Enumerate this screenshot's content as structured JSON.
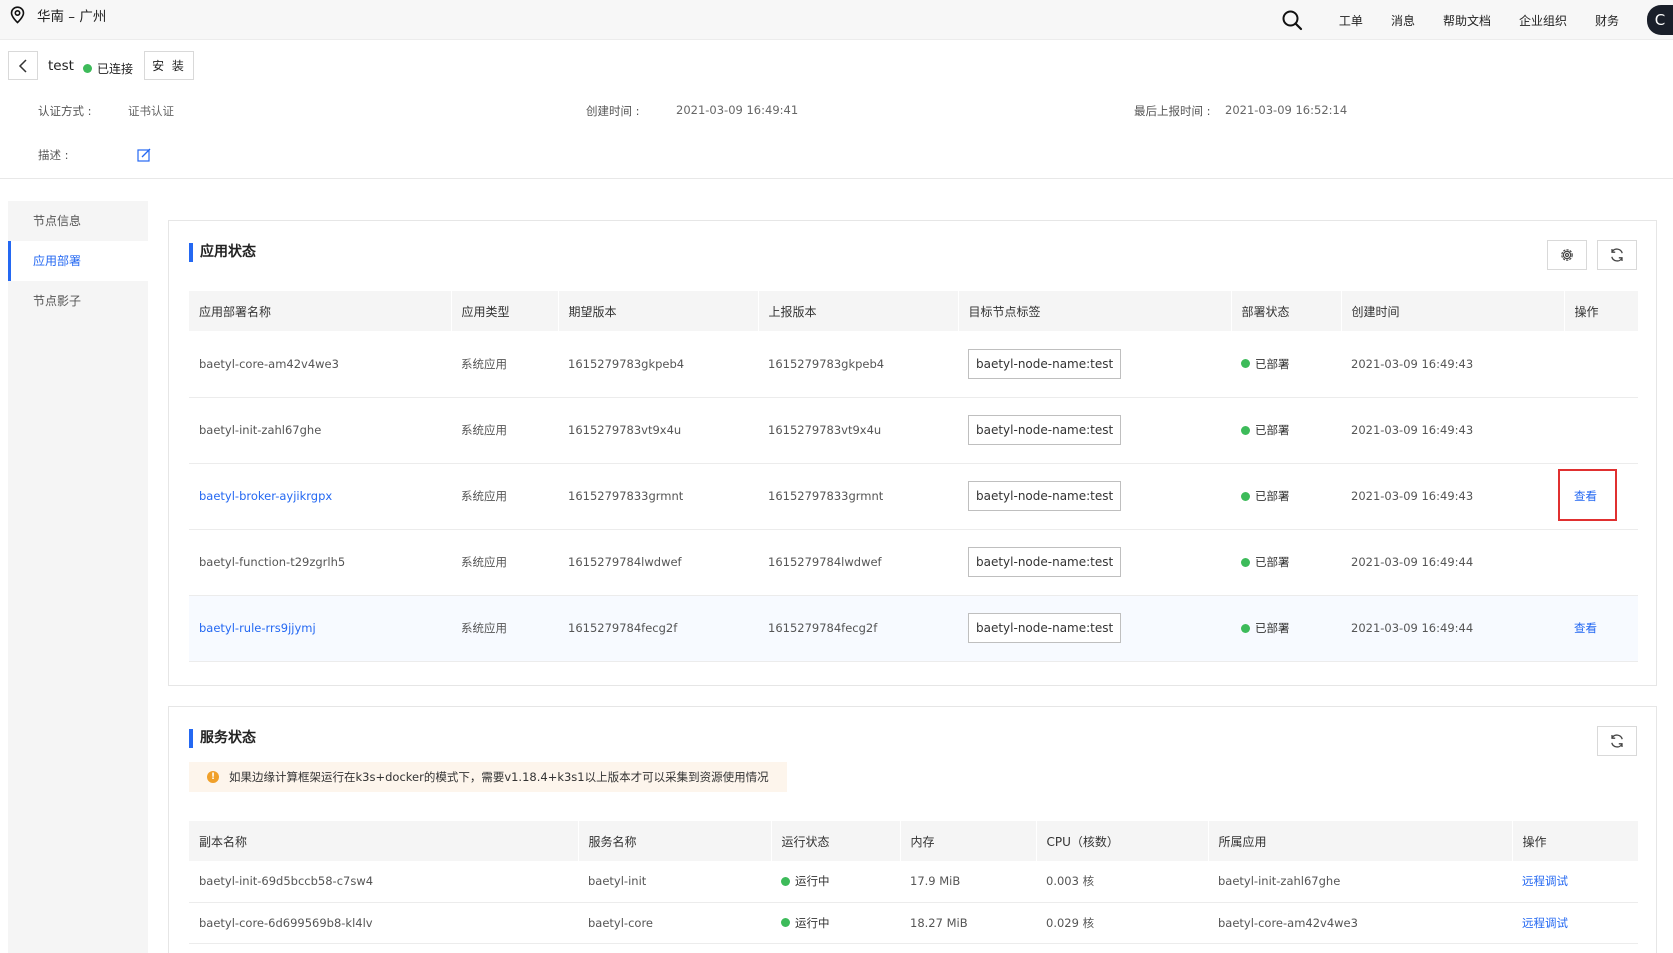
{
  "topbar": {
    "region": "华南 – 广州",
    "links": [
      "工单",
      "消息",
      "帮助文档",
      "企业组织",
      "财务"
    ],
    "avatar": "C"
  },
  "node": {
    "name": "test",
    "status": "已连接",
    "install_label": "安 装",
    "auth_label": "认证方式 :",
    "auth_value": "证书认证",
    "created_label": "创建时间 :",
    "created_value": "2021-03-09 16:49:41",
    "reported_label": "最后上报时间 :",
    "reported_value": "2021-03-09 16:52:14",
    "desc_label": "描述 :"
  },
  "sidenav": [
    "节点信息",
    "应用部署",
    "节点影子"
  ],
  "app_status": {
    "title": "应用状态",
    "columns": [
      "应用部署名称",
      "应用类型",
      "期望版本",
      "上报版本",
      "目标节点标签",
      "部署状态",
      "创建时间",
      "操作"
    ],
    "rows": [
      {
        "name": "baetyl-core-am42v4we3",
        "type": "系统应用",
        "expected": "1615279783gkpeb4",
        "reported": "1615279783gkpeb4",
        "tag": "baetyl-node-name:test",
        "status": "已部署",
        "created": "2021-03-09 16:49:43",
        "action": ""
      },
      {
        "name": "baetyl-init-zahl67ghe",
        "type": "系统应用",
        "expected": "1615279783vt9x4u",
        "reported": "1615279783vt9x4u",
        "tag": "baetyl-node-name:test",
        "status": "已部署",
        "created": "2021-03-09 16:49:43",
        "action": ""
      },
      {
        "name": "baetyl-broker-ayjikrgpx",
        "type": "系统应用",
        "expected": "16152797833grmnt",
        "reported": "16152797833grmnt",
        "tag": "baetyl-node-name:test",
        "status": "已部署",
        "created": "2021-03-09 16:49:43",
        "action": "查看"
      },
      {
        "name": "baetyl-function-t29zgrlh5",
        "type": "系统应用",
        "expected": "1615279784lwdwef",
        "reported": "1615279784lwdwef",
        "tag": "baetyl-node-name:test",
        "status": "已部署",
        "created": "2021-03-09 16:49:44",
        "action": ""
      },
      {
        "name": "baetyl-rule-rrs9jjymj",
        "type": "系统应用",
        "expected": "1615279784fecg2f",
        "reported": "1615279784fecg2f",
        "tag": "baetyl-node-name:test",
        "status": "已部署",
        "created": "2021-03-09 16:49:44",
        "action": "查看"
      }
    ]
  },
  "service_status": {
    "title": "服务状态",
    "warning": "如果边缘计算框架运行在k3s+docker的模式下，需要v1.18.4+k3s1以上版本才可以采集到资源使用情况",
    "columns": [
      "副本名称",
      "服务名称",
      "运行状态",
      "内存",
      "CPU（核数）",
      "所属应用",
      "操作"
    ],
    "rows": [
      {
        "replica": "baetyl-init-69d5bccb58-c7sw4",
        "service": "baetyl-init",
        "status": "运行中",
        "memory": "17.9 MiB",
        "cpu": "0.003 核",
        "app": "baetyl-init-zahl67ghe",
        "action": "远程调试"
      },
      {
        "replica": "baetyl-core-6d699569b8-kl4lv",
        "service": "baetyl-core",
        "status": "运行中",
        "memory": "18.27 MiB",
        "cpu": "0.029 核",
        "app": "baetyl-core-am42v4we3",
        "action": "远程调试"
      }
    ]
  },
  "colors": {
    "accent": "#2468f2",
    "success": "#3dbb5a",
    "warning": "#f0a02a",
    "highlight": "#e03030"
  }
}
